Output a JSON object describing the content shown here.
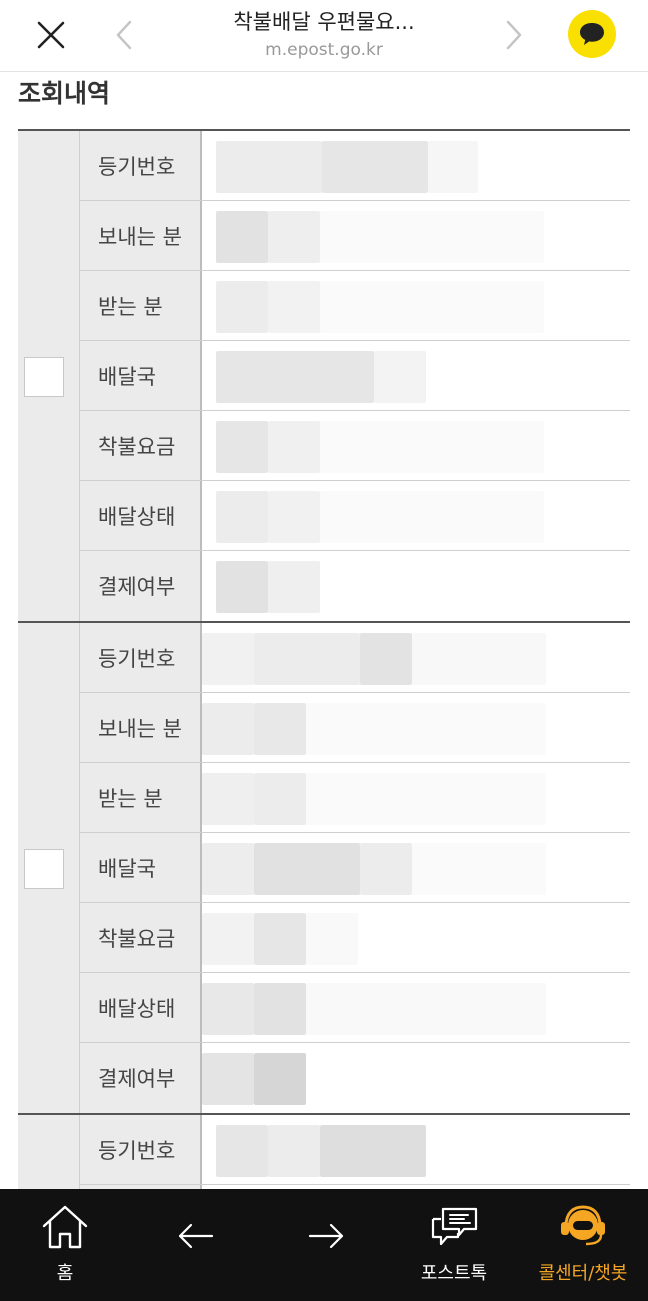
{
  "header": {
    "title": "착불배달 우편물요...",
    "url": "m.epost.go.kr"
  },
  "section_title": "조회내역",
  "records": [
    {
      "labels": [
        "등기번호",
        "보내는 분",
        "받는 분",
        "배달국",
        "착불요금",
        "배달상태",
        "결제여부"
      ]
    },
    {
      "labels": [
        "등기번호",
        "보내는 분",
        "받는 분",
        "배달국",
        "착불요금",
        "배달상태",
        "결제여부"
      ]
    },
    {
      "labels": [
        "등기번호"
      ]
    }
  ],
  "bottom_nav": {
    "home_label": "홈",
    "posttalk_label": "포스트톡",
    "callcenter_label": "콜센터/챗봇"
  },
  "colors": {
    "kakao_yellow": "#f9e000",
    "nav_highlight": "#f5a623",
    "nav_background": "#111111"
  }
}
